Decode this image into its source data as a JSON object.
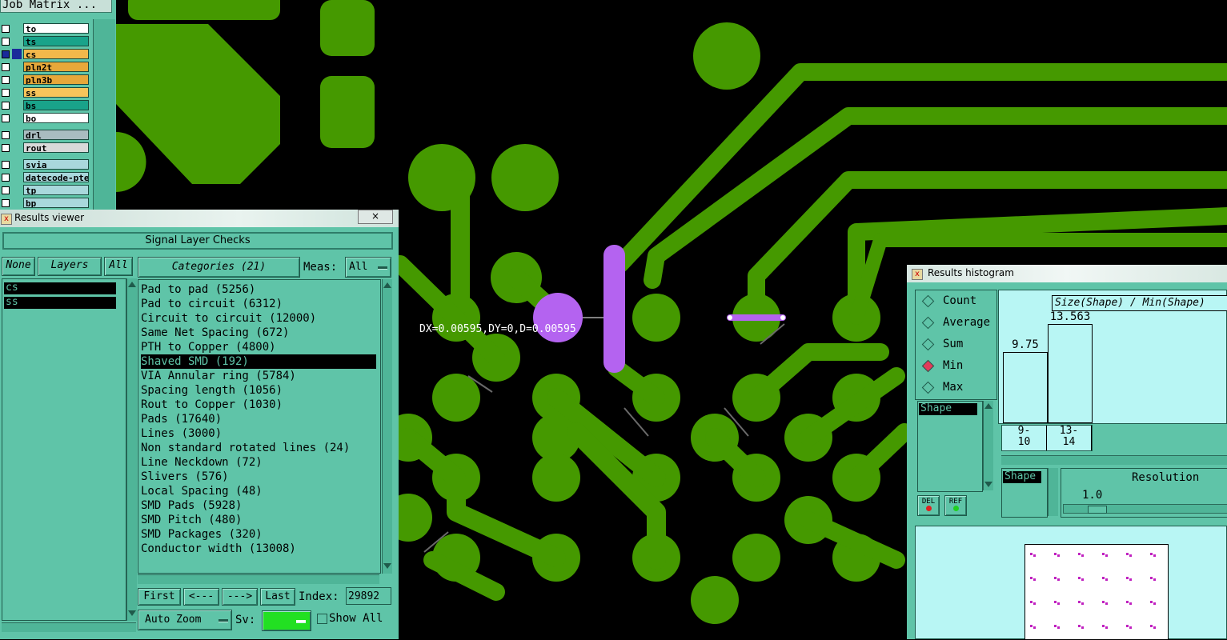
{
  "job_matrix": {
    "title": "Job Matrix ...",
    "layers": [
      {
        "name": "to",
        "color": "#ffffff"
      },
      {
        "name": "ts",
        "color": "#19a38a"
      },
      {
        "name": "cs",
        "color": "#f2b84b"
      },
      {
        "name": "pln2t",
        "color": "#e7a83a"
      },
      {
        "name": "pln3b",
        "color": "#e7a83a"
      },
      {
        "name": "ss",
        "color": "#f7c45a"
      },
      {
        "name": "bs",
        "color": "#19a38a"
      },
      {
        "name": "bo",
        "color": "#ffffff"
      },
      {
        "name": "drl",
        "color": "#a9bcc0"
      },
      {
        "name": "rout",
        "color": "#d9d9d9"
      },
      {
        "name": "svia",
        "color": "#a9d8dc"
      },
      {
        "name": "datecode-pte",
        "color": "#a9d8dc"
      },
      {
        "name": "tp",
        "color": "#a9d8dc"
      },
      {
        "name": "bp",
        "color": "#a9d8dc"
      }
    ]
  },
  "results_viewer": {
    "title": "Results viewer",
    "close": "×",
    "header": "Signal Layer Checks",
    "none_btn": "None",
    "layers_btn": "Layers",
    "all_btn": "All",
    "categories_btn": "Categories (21)",
    "meas_label": "Meas:",
    "meas_value": "All",
    "layers": [
      "cs",
      "ss"
    ],
    "categories": [
      "Pad to pad (5256)",
      "Pad to circuit (6312)",
      "Circuit to circuit (12000)",
      "Same Net Spacing (672)",
      "PTH to Copper (4800)",
      "Shaved SMD (192)",
      "VIA Annular ring (5784)",
      "Spacing length (1056)",
      "Rout to Copper (1030)",
      "Pads (17640)",
      "Lines (3000)",
      "Non standard rotated lines (24)",
      "Line Neckdown (72)",
      "Slivers (576)",
      "Local Spacing (48)",
      "SMD Pads (5928)",
      "SMD Pitch (480)",
      "SMD Packages (320)",
      "Conductor width (13008)"
    ],
    "selected_category_index": 5,
    "first_btn": "First",
    "prev_btn": "<---",
    "next_btn": "--->",
    "last_btn": "Last",
    "index_label": "Index:",
    "index_value": "29892",
    "auto_zoom": "Auto Zoom",
    "sv_label": "Sv:",
    "show_all": "Show All"
  },
  "measurement": {
    "label": "DX=0.00595,DY=0,D=0.00595"
  },
  "histogram": {
    "title": "Results histogram",
    "modes": [
      {
        "label": "Count",
        "selected": false
      },
      {
        "label": "Average",
        "selected": false
      },
      {
        "label": "Sum",
        "selected": false
      },
      {
        "label": "Min",
        "selected": true
      },
      {
        "label": "Max",
        "selected": false
      }
    ],
    "plot_title": "Size(Shape) / Min(Shape)",
    "bars": [
      {
        "value": 9.75,
        "label": "9.75",
        "bin": "9-\n10"
      },
      {
        "value": 13.563,
        "label": "13.563",
        "bin": "13-\n14"
      }
    ],
    "shape_label": "Shape",
    "del_btn": "DEL",
    "ref_btn": "REF",
    "shape_label2": "Shape",
    "resolution_label": "Resolution",
    "resolution_value": "1.0"
  },
  "colors": {
    "copper": "#459900",
    "panel": "#5fc4a8",
    "highlight": "#b463f0"
  }
}
